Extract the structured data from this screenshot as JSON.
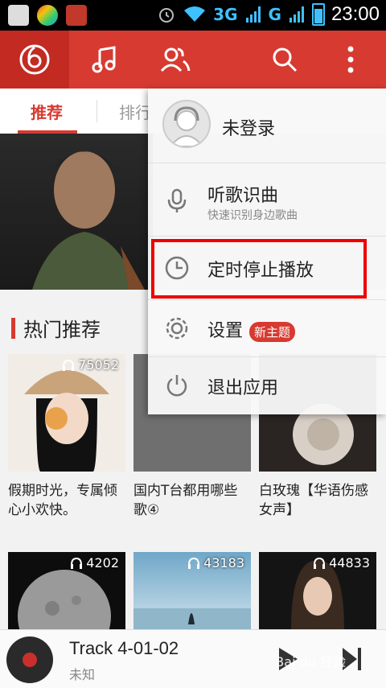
{
  "status_bar": {
    "network_3g": "3G",
    "network_g": "G",
    "time": "23:00"
  },
  "top_bar": {
    "icons": [
      "netease-music-logo-icon",
      "music-note-icon",
      "friends-icon",
      "search-icon",
      "more-vertical-icon"
    ]
  },
  "tabs": [
    {
      "label": "推荐",
      "active": true
    },
    {
      "label": "排行",
      "active": false
    }
  ],
  "section": {
    "title": "热门推荐"
  },
  "cards": [
    {
      "count": "75052",
      "title": "假期时光，专属倾心小欢快。"
    },
    {
      "count": "",
      "title": "国内T台都用哪些歌④"
    },
    {
      "count": "",
      "title": "白玫瑰【华语伤感女声】"
    },
    {
      "count": "4202",
      "title": ""
    },
    {
      "count": "43183",
      "title": ""
    },
    {
      "count": "44833",
      "title": ""
    }
  ],
  "player": {
    "track": "Track 4-01-02",
    "artist": "未知"
  },
  "menu": {
    "login": "未登录",
    "items": [
      {
        "label": "听歌识曲",
        "sub": "快速识别身边歌曲",
        "icon": "microphone-icon"
      },
      {
        "label": "定时停止播放",
        "sub": "",
        "icon": "clock-icon"
      },
      {
        "label": "设置",
        "sub": "",
        "icon": "gear-icon",
        "badge": "新主题"
      },
      {
        "label": "退出应用",
        "sub": "",
        "icon": "power-icon"
      }
    ]
  },
  "colors": {
    "accent": "#d73a31",
    "accent_dark": "#c22a22"
  }
}
